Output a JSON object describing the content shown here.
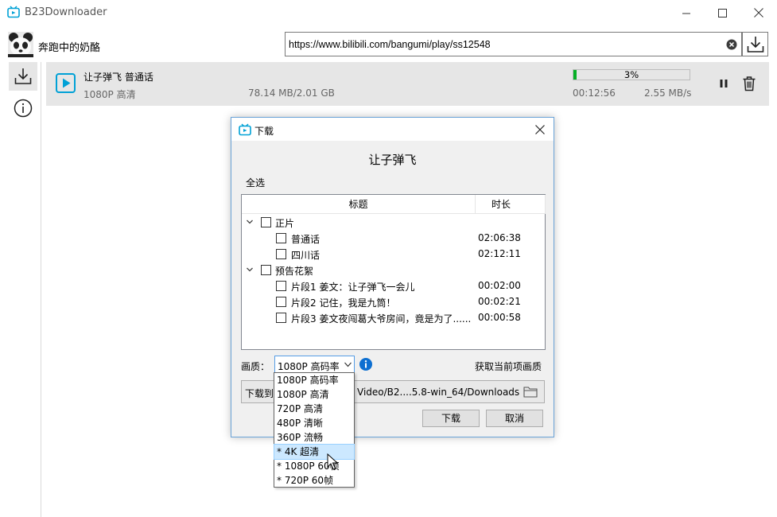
{
  "window": {
    "title": "B23Downloader"
  },
  "header": {
    "username": "奔跑中的奶酪",
    "url_value": "https://www.bilibili.com/bangumi/play/ss12548"
  },
  "task": {
    "title": "让子弹飞 普通话",
    "quality": "1080P 高清",
    "size": "78.14 MB/2.01 GB",
    "progress": 0.03,
    "progress_text": "3%",
    "elapsed": "00:12:56",
    "speed": "2.55 MB/s"
  },
  "dialog": {
    "title": "下载",
    "heading": "让子弹飞",
    "select_all": "全选",
    "columns": {
      "title": "标题",
      "duration": "时长"
    },
    "groups": [
      {
        "label": "正片",
        "items": [
          {
            "label": "普通话",
            "duration": "02:06:38"
          },
          {
            "label": "四川话",
            "duration": "02:12:11"
          }
        ]
      },
      {
        "label": "预告花絮",
        "items": [
          {
            "label": "片段1 姜文：让子弹飞一会儿",
            "duration": "00:02:00"
          },
          {
            "label": "片段2 记住，我是九筒！",
            "duration": "00:02:21"
          },
          {
            "label": "片段3 姜文夜闯葛大爷房间，竟是为了......",
            "duration": "00:00:58"
          }
        ]
      }
    ],
    "quality_label": "画质：",
    "quality_selected": "1080P 高码率",
    "fetch_quality": "获取当前项画质",
    "download_to_label": "下载到：",
    "download_path": "Video/B2....5.8-win_64/Downloads",
    "ok_label": "下载",
    "cancel_label": "取消"
  },
  "quality_options": [
    "1080P 高码率",
    "1080P 高清",
    "720P 高清",
    "480P 清晰",
    "360P 流畅",
    "* 4K 超清",
    "* 1080P 60帧",
    "* 720P 60帧"
  ],
  "colors": {
    "accent": "#0078d7",
    "brand": "#00a1d6",
    "progress": "#06b025",
    "selection": "#cce8ff"
  }
}
